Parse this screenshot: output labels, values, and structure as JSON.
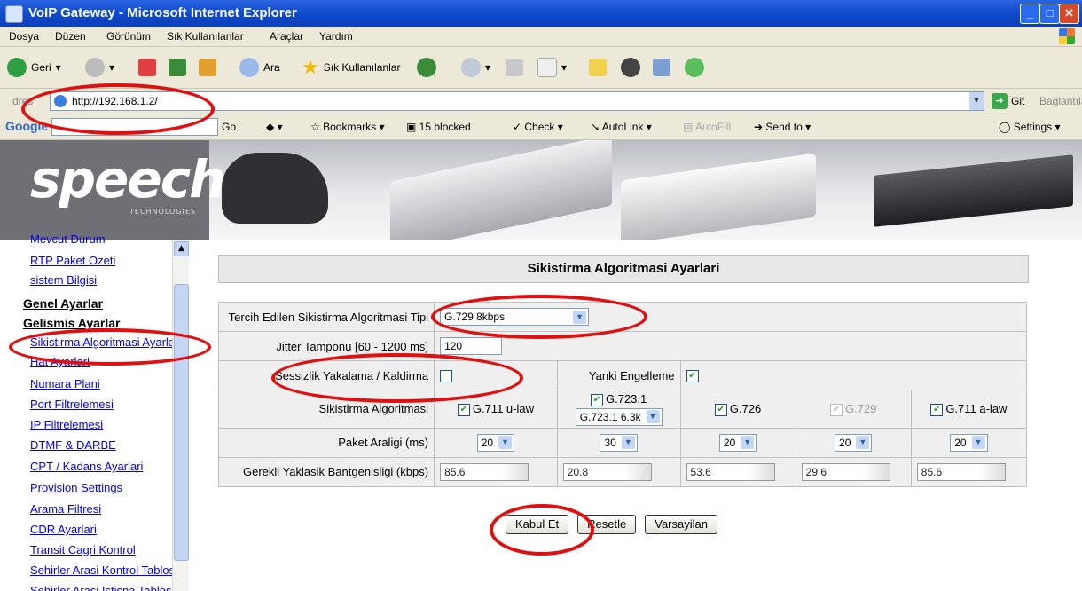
{
  "window": {
    "title": "VoIP Gateway - Microsoft Internet Explorer"
  },
  "menu": [
    "Dosya",
    "Düzen",
    "Görünüm",
    "Sık Kullanılanlar",
    "Araçlar",
    "Yardım"
  ],
  "toolbar": {
    "back": "Geri",
    "search": "Ara",
    "favorites": "Sık Kullanılanlar"
  },
  "address": {
    "label": "dres",
    "url": "http://192.168.1.2/",
    "go": "Git",
    "links": "Bağlantılar"
  },
  "google": {
    "go": "Go",
    "bookmarks": "Bookmarks",
    "blocked": "15 blocked",
    "check": "Check",
    "autolink": "AutoLink",
    "autofill": "AutoFill",
    "sendto": "Send to",
    "settings": "Settings"
  },
  "logo": {
    "text": "speech",
    "sub": "TECHNOLOGIES"
  },
  "sidebar": {
    "links_top": [
      "Mevcut Durum",
      "RTP Paket Ozeti",
      "sistem Bilgisi"
    ],
    "head1": "Genel Ayarlar",
    "head2": "Gelismis Ayarlar",
    "links": [
      "Sikistirma Algoritmasi Ayarlari",
      "Hat Ayarlari",
      "Numara Plani",
      "Port Filtrelemesi",
      "IP Filtrelemesi",
      "DTMF & DARBE",
      "CPT / Kadans Ayarlari",
      "Provision Settings",
      "Arama Filtresi",
      "CDR Ayarlari",
      "Transit Cagri Kontrol",
      "Sehirler Arasi Kontrol Tablosu",
      "Sehirler Arasi Istisna Tablosu"
    ]
  },
  "panel": {
    "title": "Sikistirma Algoritmasi Ayarlari",
    "row1": {
      "label": "Tercih Edilen Sikistirma Algoritmasi Tipi",
      "value": "G.729 8kbps"
    },
    "row2": {
      "label": "Jitter Tamponu [60 - 1200 ms]",
      "value": "120"
    },
    "row3": {
      "label": "Sessizlik Yakalama / Kaldirma",
      "echo_label": "Yanki Engelleme"
    },
    "row4": {
      "label": "Sikistirma Algoritmasi",
      "codecs": [
        "G.711 u-law",
        "G.723.1",
        "G.726",
        "G.729",
        "G.711 a-law"
      ],
      "g7231_rate": "G.723.1 6.3k"
    },
    "row5": {
      "label": "Paket Araligi (ms)",
      "values": [
        "20",
        "30",
        "20",
        "20",
        "20"
      ]
    },
    "row6": {
      "label": "Gerekli Yaklasik Bantgenisligi (kbps)",
      "values": [
        "85.6",
        "20.8",
        "53.6",
        "29.6",
        "85.6"
      ]
    }
  },
  "buttons": {
    "apply": "Kabul Et",
    "reset": "Resetle",
    "default": "Varsayilan"
  }
}
